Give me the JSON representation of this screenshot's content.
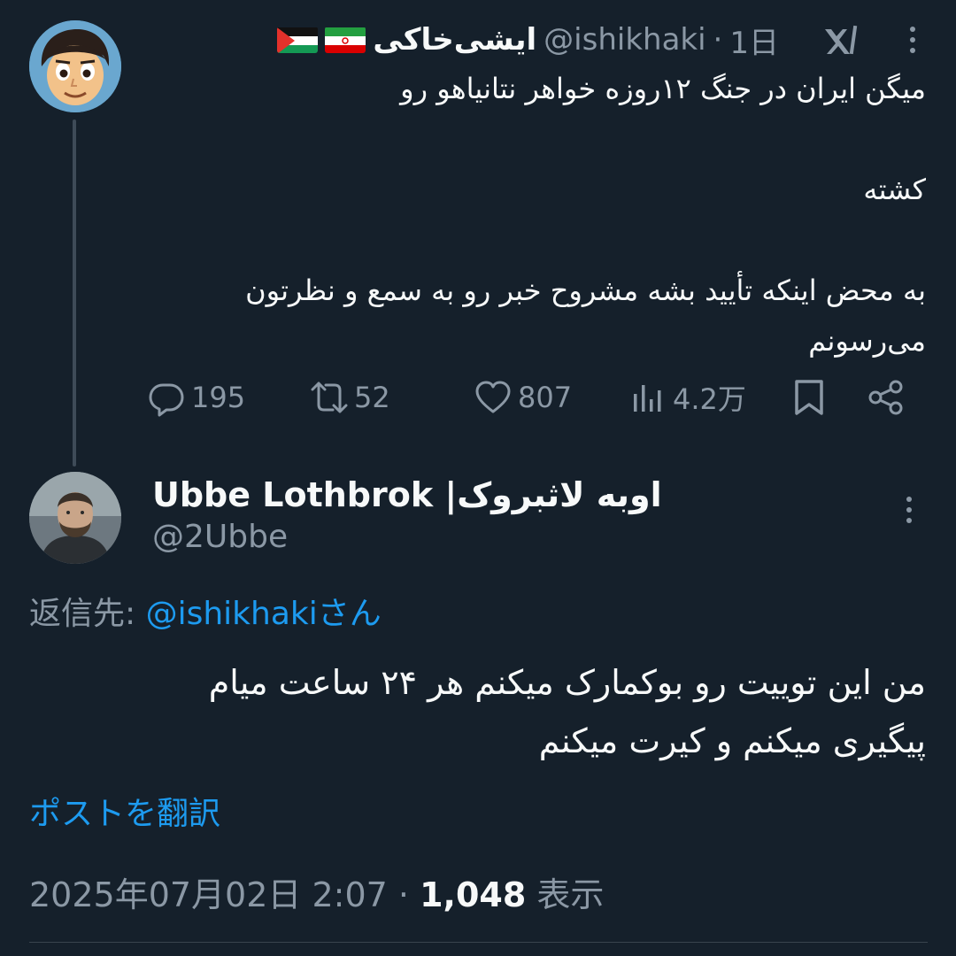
{
  "parent_tweet": {
    "author_name": "ایشی‌خاکی",
    "handle": "@ishikhaki",
    "separator": "·",
    "time": "1日",
    "flags": [
      "palestine-flag",
      "iran-flag"
    ],
    "lines": [
      "میگن ایران در جنگ ۱۲روزه خواهر نتانیاهو رو",
      "کشته",
      "به محض اینکه تأیید بشه مشروح خبر رو به سمع و نظرتون",
      "می‌رسونم"
    ],
    "actions": {
      "replies": "195",
      "retweets": "52",
      "likes": "807",
      "views": "4.2万"
    }
  },
  "reply_tweet": {
    "author_name": "Ubbe Lothbrok |اوبه لاثبروک",
    "handle": "@2Ubbe",
    "reply_to_label": "返信先: ",
    "reply_to_mention": "@ishikhakiさん",
    "lines": [
      "من این توییت رو بوکمارک میکنم هر ۲۴ ساعت میام",
      "پیگیری میکنم و کیرت میکنم"
    ],
    "translate_label": "ポストを翻訳",
    "timestamp": "2025年07月02日 2:07",
    "separator": " · ",
    "views_count": "1,048",
    "views_label": " 表示"
  },
  "colors": {
    "background": "#15202b",
    "text_primary": "#f7f9f9",
    "text_secondary": "#8b98a5",
    "link": "#1d9bf0"
  }
}
